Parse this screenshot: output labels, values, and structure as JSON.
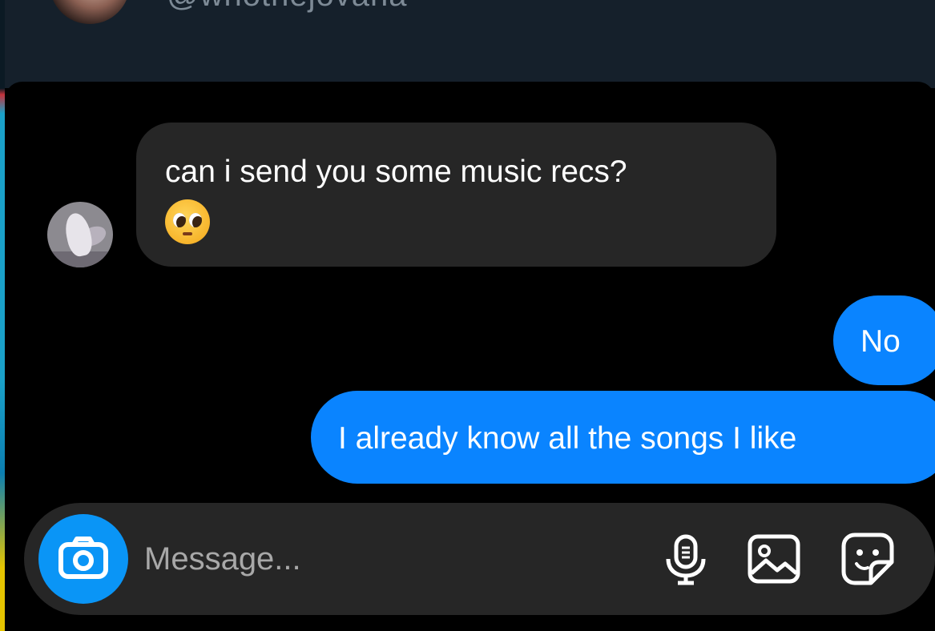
{
  "header": {
    "handle": "@whothejovana",
    "avatar_icon": "profile-photo"
  },
  "messages": [
    {
      "direction": "received",
      "text": "can i send you some music recs?",
      "emoji": "🥺",
      "sender_avatar_icon": "bird-photo"
    },
    {
      "direction": "sent",
      "text": "No"
    },
    {
      "direction": "sent",
      "text": "I already know all the songs I like"
    }
  ],
  "composer": {
    "placeholder": "Message...",
    "value": "",
    "camera_icon": "camera-icon",
    "mic_icon": "microphone-icon",
    "gallery_icon": "image-icon",
    "sticker_icon": "sticker-icon"
  },
  "colors": {
    "background": "#000000",
    "header_background": "#15202b",
    "received_bubble": "#262626",
    "sent_bubble": "#0a84ff",
    "camera_button": "#0a95f6",
    "placeholder_text": "#a8a8a8"
  }
}
